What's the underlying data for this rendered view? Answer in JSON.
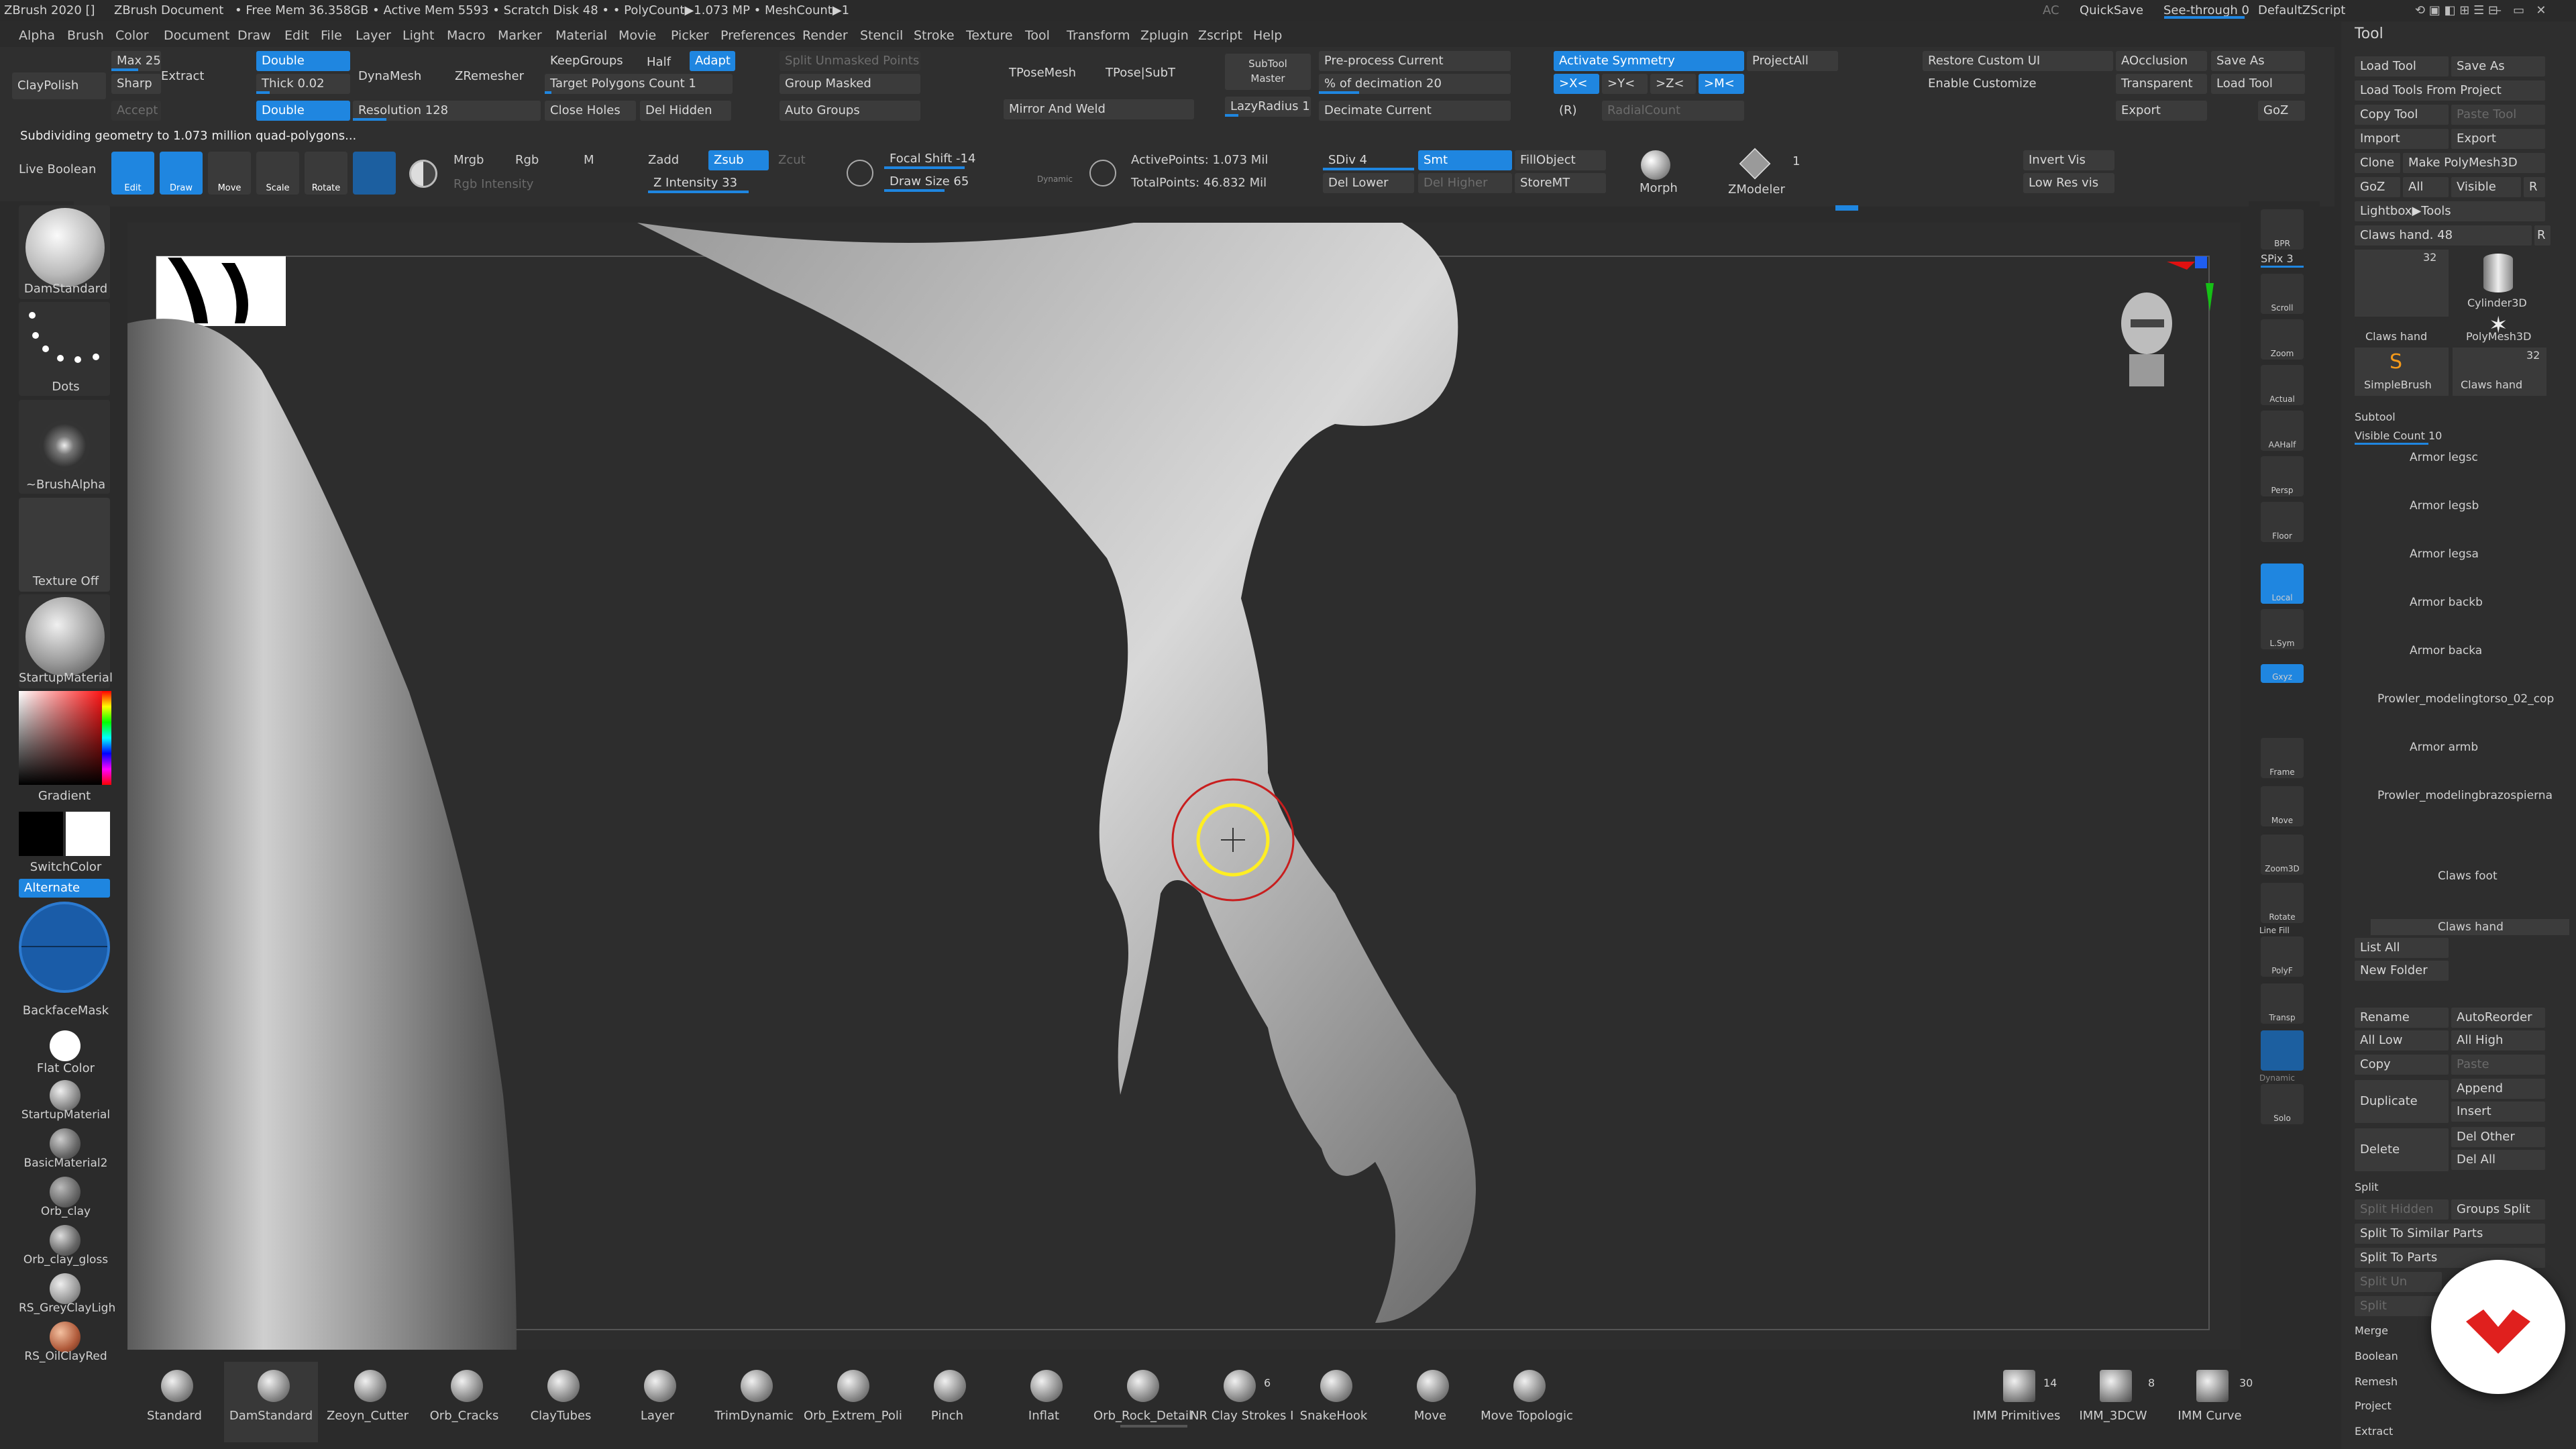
{
  "titlebar": {
    "app": "ZBrush 2020 []",
    "doc": "ZBrush Document",
    "stats": "• Free Mem 36.358GB • Active Mem 5593 • Scratch Disk 48 • • PolyCount▶1.073 MP • MeshCount▶1",
    "ac": "AC",
    "quicksave": "QuickSave",
    "seethrough": "See-through 0",
    "script": "DefaultZScript"
  },
  "menu": [
    "Alpha",
    "Brush",
    "Color",
    "Document",
    "Draw",
    "Edit",
    "File",
    "Layer",
    "Light",
    "Macro",
    "Marker",
    "Material",
    "Movie",
    "Picker",
    "Preferences",
    "Render",
    "Stencil",
    "Stroke",
    "Texture",
    "Tool",
    "Transform",
    "Zplugin",
    "Zscript",
    "Help"
  ],
  "topshelf": {
    "claypolish": "ClayPolish",
    "max": "Max 25",
    "sharp": "Sharp",
    "extract": "Extract",
    "accept": "Accept",
    "double1": "Double",
    "thick": "Thick 0.02",
    "double2": "Double",
    "dynamesh": "DynaMesh",
    "zremesher": "ZRemesher",
    "resolution": "Resolution 128",
    "keepgroups": "KeepGroups",
    "half": "Half",
    "adapt": "Adapt",
    "target": "Target Polygons Count 1",
    "closeholes": "Close Holes",
    "delhidden": "Del Hidden",
    "splitunmasked": "Split Unmasked Points",
    "groupmasked": "Group Masked",
    "autogroups": "Auto Groups",
    "tposemesh": "TPoseMesh",
    "tposesubt": "TPose|SubT",
    "mirrorweld": "Mirror And Weld",
    "subtoolmaster": "SubTool Master",
    "lazyradius": "LazyRadius 1",
    "preprocess": "Pre-process Current",
    "decimation": "% of decimation 20",
    "decimate": "Decimate Current",
    "activatesym": "Activate Symmetry",
    "projectall": "ProjectAll",
    "x": ">X<",
    "y": ">Y<",
    "z": ">Z<",
    "m": ">M<",
    "r": "(R)",
    "radialcount": "RadialCount",
    "restore": "Restore Custom UI",
    "enablecustom": "Enable Customize",
    "aocclusion": "AOcclusion",
    "transparent": "Transparent",
    "export": "Export",
    "saveas": "Save As",
    "loadtool": "Load Tool",
    "goz": "GoZ",
    "status": "Subdividing geometry to 1.073 million quad-polygons...",
    "liveboolean": "Live Boolean",
    "edit": "Edit",
    "draw": "Draw",
    "move": "Move",
    "scale": "Scale",
    "rotate": "Rotate",
    "mrgb": "Mrgb",
    "rgb": "Rgb",
    "mm": "M",
    "rgbintensity": "Rgb Intensity",
    "zadd": "Zadd",
    "zsub": "Zsub",
    "zcut": "Zcut",
    "zintensity": "Z Intensity 33",
    "focalshift": "Focal Shift -14",
    "drawsize": "Draw Size 65",
    "dynamic": "Dynamic",
    "activepoints": "ActivePoints: 1.073 Mil",
    "totalpoints": "TotalPoints: 46.832 Mil",
    "sdiv": "SDiv 4",
    "smt": "Smt",
    "fillobject": "FillObject",
    "dellower": "Del Lower",
    "delhigher": "Del Higher",
    "storemt": "StoreMT",
    "morph": "Morph",
    "zmodeler": "ZModeler",
    "one": "1",
    "invertvis": "Invert Vis",
    "lowresvis": "Low Res vis"
  },
  "leftshelf": {
    "damstandard": "DamStandard",
    "dots": "Dots",
    "brushalpha": "~BrushAlpha",
    "textureoff": "Texture Off",
    "startupmaterial": "StartupMaterial",
    "gradient": "Gradient",
    "switchcolor": "SwitchColor",
    "alternate": "Alternate",
    "backfacemask": "BackfaceMask",
    "flatcolor": "Flat Color",
    "materials": [
      "StartupMaterial",
      "BasicMaterial2",
      "Orb_clay",
      "Orb_clay_gloss",
      "RS_GreyClayLigh",
      "RS_OilClayRed"
    ]
  },
  "rightshelf": {
    "bpr": "BPR",
    "spix": "SPix 3",
    "buttons": [
      "Scroll",
      "Zoom",
      "Actual",
      "AAHalf",
      "Persp",
      "Floor",
      "Local",
      "L.Sym",
      "Gxyz",
      "Frame",
      "Move",
      "Zoom3D",
      "Rotate",
      "PolyF",
      "Transp",
      "Dynamic",
      "Solo"
    ],
    "dynamic_label": "Dynamic",
    "linefill": "Line Fill"
  },
  "toolpanel": {
    "title": "Tool",
    "loadtool": "Load Tool",
    "saveas": "Save As",
    "loadfromproject": "Load Tools From Project",
    "copytool": "Copy Tool",
    "pastetool": "Paste Tool",
    "import": "Import",
    "export": "Export",
    "clone": "Clone",
    "makepolymesh": "Make PolyMesh3D",
    "goz": "GoZ",
    "all": "All",
    "visible": "Visible",
    "r": "R",
    "lightbox": "Lightbox▶Tools",
    "clawshand48": "Claws hand. 48",
    "clawshand": "Claws hand",
    "cylinder": "Cylinder3D",
    "polymesh": "PolyMesh3D",
    "simplebrush": "SimpleBrush",
    "n32a": "32",
    "n32b": "32",
    "subtool": "Subtool",
    "visiblecount": "Visible Count 10",
    "subtools": [
      "Armor legsc",
      "Armor legsb",
      "Armor legsa",
      "Armor backb",
      "Armor backa",
      "Prowler_modelingtorso_02_cop",
      "Armor armb",
      "Prowler_modelingbrazospierna",
      "Claws foot",
      "Claws hand"
    ],
    "listall": "List All",
    "newfolder": "New Folder",
    "rename": "Rename",
    "autoreorder": "AutoReorder",
    "alllow": "All Low",
    "allhigh": "All High",
    "copy": "Copy",
    "paste": "Paste",
    "duplicate": "Duplicate",
    "append": "Append",
    "insert": "Insert",
    "delete": "Delete",
    "delother": "Del Other",
    "delall": "Del All",
    "split": "Split",
    "splithidden": "Split Hidden",
    "groupssplit": "Groups Split",
    "splitsimilar": "Split To Similar Parts",
    "splitparts": "Split To Parts",
    "splitun": "Split Un",
    "splitx": "Split",
    "merge": "Merge",
    "boolean": "Boolean",
    "remesh": "Remesh",
    "project": "Project",
    "extract": "Extract"
  },
  "bottombar": {
    "brushes": [
      "Standard",
      "DamStandard",
      "Zeoyn_Cutter",
      "Orb_Cracks",
      "ClayTubes",
      "Layer",
      "TrimDynamic",
      "Orb_Extrem_Poli",
      "Pinch",
      "Inflat",
      "Orb_Rock_Detail",
      "NR Clay Strokes I",
      "SnakeHook",
      "Move",
      "Move Topologic"
    ],
    "claystrokes_count": "6",
    "imm": [
      "IMM Primitives",
      "IMM_3DCW",
      "IMM Curve"
    ],
    "imm_counts": [
      "14",
      "8",
      "30"
    ]
  },
  "colors": {
    "accent": "#1f86e0",
    "bg": "#2b2b2b",
    "cursor": "#ffee22"
  }
}
